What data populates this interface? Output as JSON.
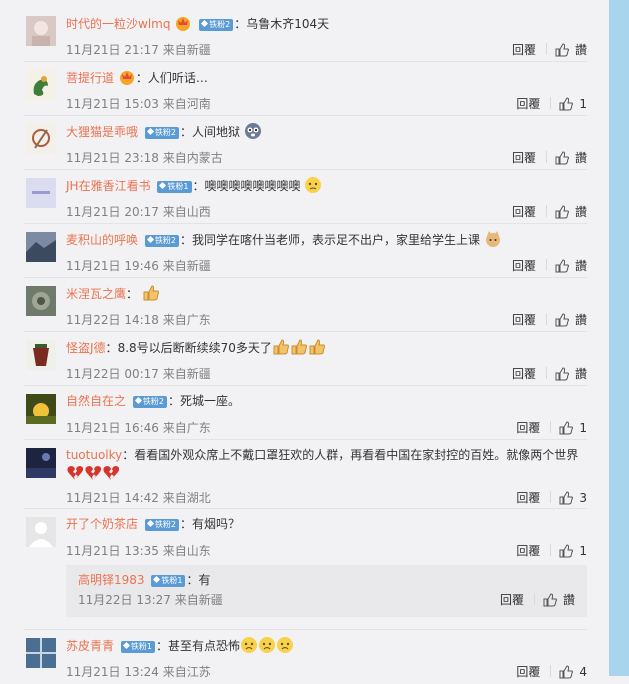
{
  "comments": [
    {
      "nick": "时代的一粒沙wlmq",
      "badge": "铁粉2",
      "text": "乌鲁木齐104天",
      "time": "11月21日 21:17",
      "from": "来自新疆",
      "reply": "回覆",
      "likes": "讚"
    },
    {
      "nick": "菩提行道",
      "badge": "",
      "text": "人们听话…",
      "time": "11月21日 15:03",
      "from": "来自河南",
      "reply": "回覆",
      "likes": "1"
    },
    {
      "nick": "大狸猫是乖哦",
      "badge": "铁粉2",
      "text": "人间地狱",
      "time": "11月21日 23:18",
      "from": "来自内蒙古",
      "reply": "回覆",
      "likes": "讚"
    },
    {
      "nick": "JH在雅香江看书",
      "badge": "铁粉1",
      "text": "噢噢噢噢噢噢噢噢",
      "time": "11月21日 20:17",
      "from": "来自山西",
      "reply": "回覆",
      "likes": "讚"
    },
    {
      "nick": "麦积山的呼唤",
      "badge": "铁粉2",
      "text": "我同学在喀什当老师，表示足不出户，家里给学生上课",
      "time": "11月21日 19:46",
      "from": "来自新疆",
      "reply": "回覆",
      "likes": "讚"
    },
    {
      "nick": "米涅瓦之鹰",
      "badge": "",
      "text": "",
      "time": "11月22日 14:18",
      "from": "来自广东",
      "reply": "回覆",
      "likes": "讚"
    },
    {
      "nick": "怪盗J德",
      "badge": "",
      "text": "8.8号以后断断续续70多天了",
      "time": "11月22日 00:17",
      "from": "来自新疆",
      "reply": "回覆",
      "likes": "讚"
    },
    {
      "nick": "自然自在之",
      "badge": "铁粉2",
      "text": "死城一座。",
      "time": "11月21日 16:46",
      "from": "来自广东",
      "reply": "回覆",
      "likes": "1"
    },
    {
      "nick": "tuotuolky",
      "badge": "",
      "text": "看看国外观众席上不戴口罩狂欢的人群，再看看中国在家封控的百姓。就像两个世界",
      "time": "11月21日 14:42",
      "from": "来自湖北",
      "reply": "回覆",
      "likes": "3"
    },
    {
      "nick": "开了个奶茶店",
      "badge": "铁粉2",
      "text": "有烟吗？",
      "time": "11月21日 13:35",
      "from": "来自山东",
      "reply": "回覆",
      "likes": "1",
      "sub": {
        "nick": "高明铎1983",
        "badge": "铁粉1",
        "text": "有",
        "time": "11月22日 13:27",
        "from": "来自新疆",
        "reply": "回覆",
        "likes": "讚"
      }
    },
    {
      "nick": "苏皮青青",
      "badge": "铁粉1",
      "text": "甚至有点恐怖",
      "time": "11月21日 13:24",
      "from": "来自江苏",
      "reply": "回覆",
      "likes": "4"
    }
  ]
}
